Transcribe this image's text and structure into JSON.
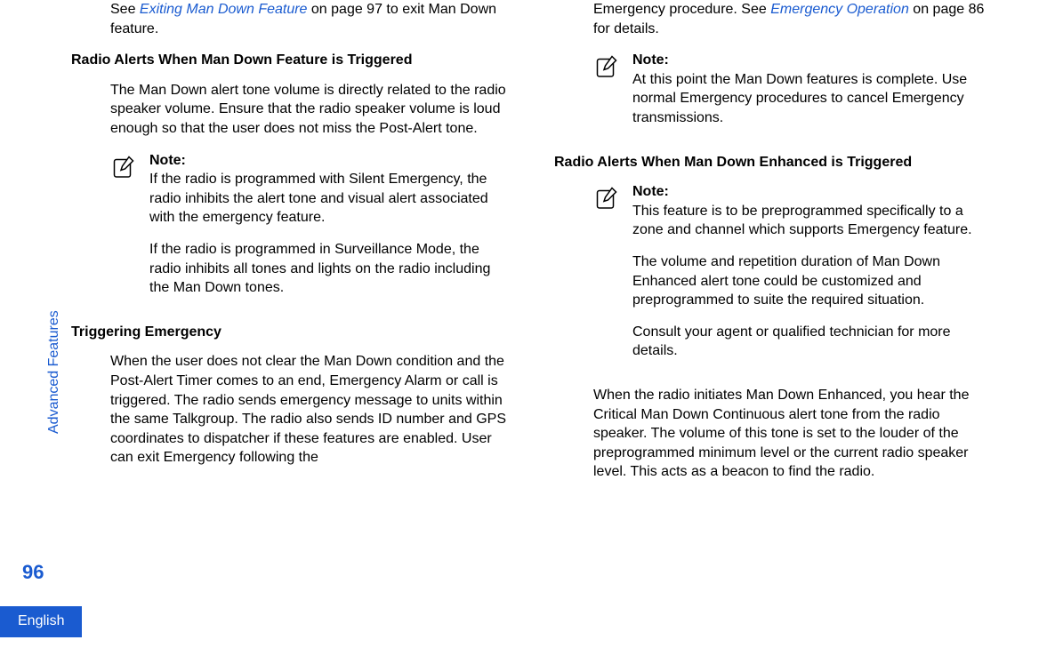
{
  "sidebar": {
    "section_label": "Advanced Features",
    "page_number": "96",
    "language": "English"
  },
  "left_column": {
    "intro_prefix": "See ",
    "intro_link": "Exiting Man Down Feature",
    "intro_suffix": " on page 97 to exit Man Down feature.",
    "section1_heading": "Radio Alerts When Man Down Feature is Triggered",
    "section1_p1": "The Man Down alert tone volume is directly related to the radio speaker volume. Ensure that the radio speaker volume is loud enough so that the user does not miss the Post-Alert tone.",
    "note1_title": "Note:",
    "note1_p1": "If the radio is programmed with Silent Emergency, the radio inhibits the alert tone and visual alert associated with the emergency feature.",
    "note1_p2": "If the radio is programmed in Surveillance Mode, the radio inhibits all tones and lights on the radio including the Man Down tones.",
    "section2_heading": "Triggering Emergency",
    "section2_p1": "When the user does not clear the Man Down condition and the Post-Alert Timer comes to an end, Emergency Alarm or call is triggered. The radio sends emergency message to units within the same Talkgroup. The radio also sends ID number and GPS coordinates to dispatcher if these features are enabled. User can exit Emergency following the"
  },
  "right_column": {
    "top_prefix": "Emergency procedure. See ",
    "top_link": "Emergency Operation",
    "top_suffix": " on page 86 for details.",
    "note2_title": "Note:",
    "note2_p1": "At this point the Man Down features is complete. Use normal Emergency procedures to cancel Emergency transmissions.",
    "section3_heading": "Radio Alerts When Man Down Enhanced is Triggered",
    "note3_title": "Note:",
    "note3_p1": "This feature is to be preprogrammed specifically to a zone and channel which supports Emergency feature.",
    "note3_p2": "The volume and repetition duration of Man Down Enhanced alert tone could be customized and preprogrammed to suite the required situation.",
    "note3_p3": "Consult your agent or qualified technician for more details.",
    "section3_p1": "When the radio initiates Man Down Enhanced, you hear the Critical Man Down Continuous alert tone from the radio speaker. The volume of this tone is set to the louder of the preprogrammed minimum level or the current radio speaker level. This acts as a beacon to find the radio."
  }
}
